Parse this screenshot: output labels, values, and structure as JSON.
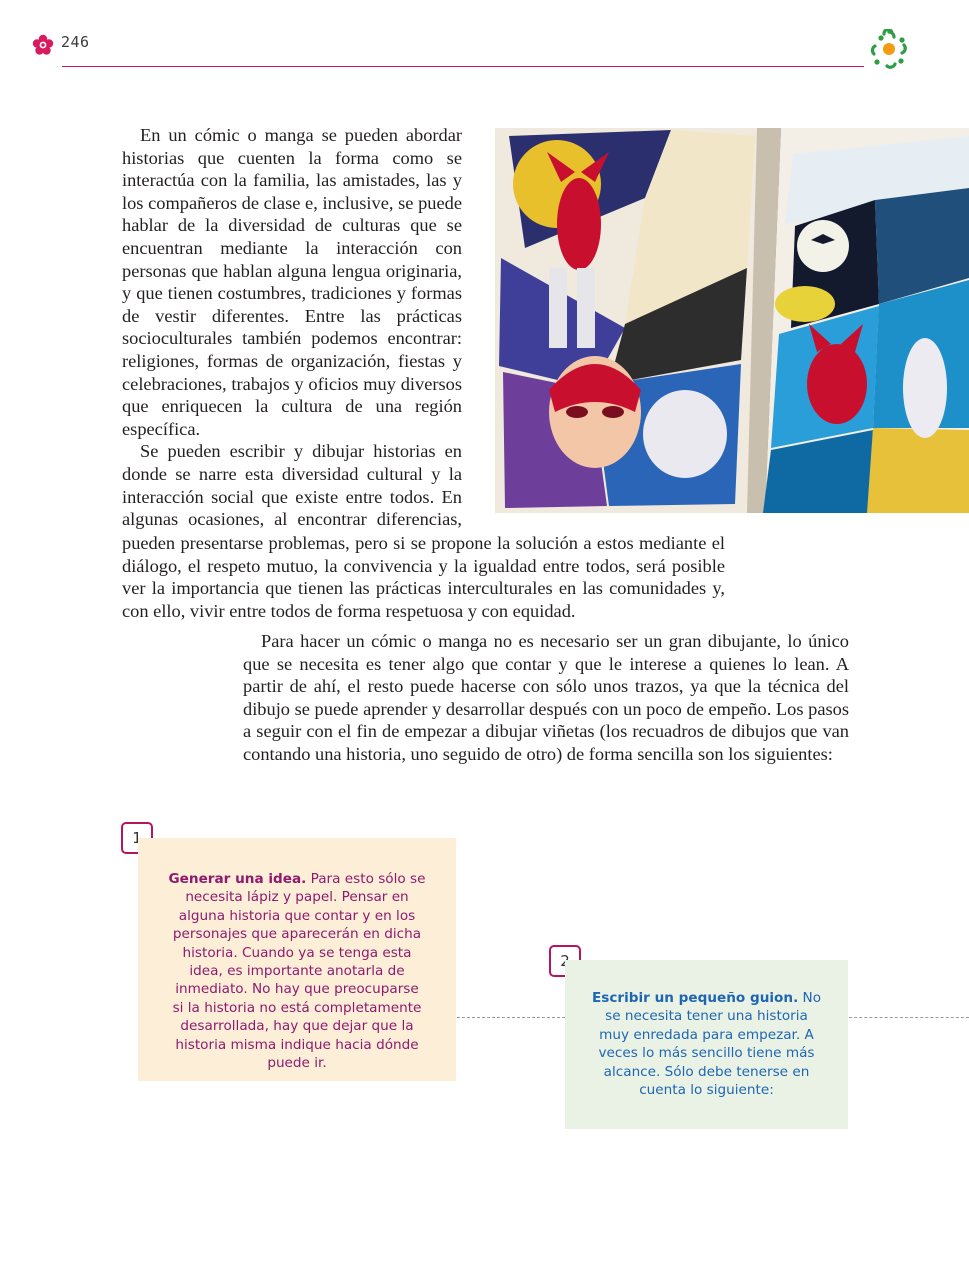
{
  "header": {
    "page_number": "246",
    "flower_icon": "pink-flower-icon",
    "logo_icon": "colorful-circle-logo-icon",
    "rule_color": "#c2185b"
  },
  "body": {
    "paragraph1_left": "En un cómic o manga se pueden abordar historias que cuenten la forma como se interactúa con la familia, las amistades, las y los compañeros de clase e, inclusive, se puede hablar de la diversidad de culturas que se encuentran mediante la interacción con personas que hablan alguna lengua originaria, y que tienen costumbres, tradiciones y formas de vestir diferentes. Entre las prácticas socioculturales también podemos encontrar: religiones, formas de organización, fiestas y celebraciones, trabajos y oficios muy diversos que enriquecen la cultura de una región específica.",
    "paragraph2_left": "Se pueden escribir y dibujar historias en donde se narre esta diversidad cultural y la interacción social que existe entre todos. En algunas ocasiones, al encontrar diferencias,",
    "paragraph2_wide": "pueden presentarse problemas, pero si se propone la solución a estos mediante el diálogo, el respeto mutuo, la convivencia y la igualdad entre todos, será posible ver la importancia que tienen las prácticas interculturales en las comunidades y, con ello, vivir entre todos de forma respetuosa y con equidad.",
    "paragraph3": "Para hacer un cómic o manga no es necesario ser un gran dibujante, lo único que se necesita es tener algo que contar y que le interese a quienes lo lean. A partir de ahí, el resto puede hacerse con sólo unos trazos, ya que la técnica del dibujo se puede aprender y desarrollar después con un poco de empeño. Los pasos a seguir con el fin de empezar a dibujar viñetas (los recuadros de dibujos que van contando una historia, uno seguido de otro) de forma sencilla son los siguientes:"
  },
  "steps": [
    {
      "number": "1",
      "title": "Generar una idea.",
      "text": " Para esto sólo se necesita lápiz y papel. Pensar en alguna historia que contar y en los personajes que aparecerán en dicha historia. Cuando ya se tenga esta idea, es importante anotarla de inmediato. No hay que preocuparse si la historia no está completamente desarrollada, hay que dejar que la historia misma indique hacia dónde puede ir.",
      "bg_color": "#fdeed8",
      "text_color": "#8e1a6e"
    },
    {
      "number": "2",
      "title": "Escribir un pequeño guion.",
      "text": " No se necesita tener una historia muy enredada para empezar. A veces lo más sencillo tiene más alcance. Sólo debe tenerse en cuenta lo siguiente:",
      "bg_color": "#eaf2e6",
      "text_color": "#1e66b2"
    }
  ],
  "colors": {
    "badge_border": "#b3165f",
    "dashes": "#9a9a9a"
  }
}
